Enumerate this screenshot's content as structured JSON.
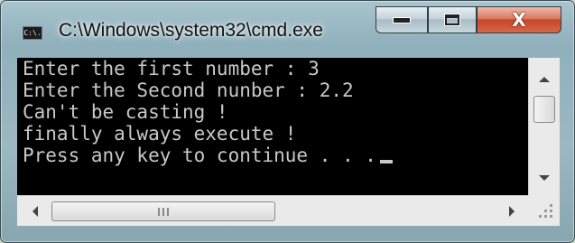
{
  "window": {
    "title": "C:\\Windows\\system32\\cmd.exe",
    "icon": "cmd-icon",
    "icon_text": "C:\\."
  },
  "caption_buttons": {
    "minimize": "minimize-icon",
    "maximize": "maximize-icon",
    "close": "close-icon",
    "close_glyph": "X"
  },
  "console": {
    "lines": [
      "Enter the first number : 3",
      "Enter the Second nunber : 2.2",
      "Can't be casting !",
      "finally always execute !",
      "Press any key to continue . . ."
    ]
  },
  "colors": {
    "console_bg": "#000000",
    "console_text": "#c8c8c8",
    "close_button": "#c4462a"
  }
}
